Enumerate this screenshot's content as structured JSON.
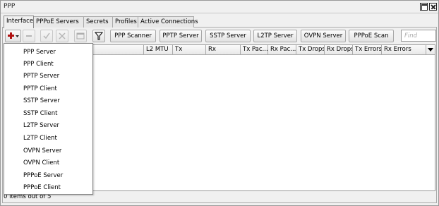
{
  "window": {
    "title": "PPP"
  },
  "tabs": [
    "Interface",
    "PPPoE Servers",
    "Secrets",
    "Profiles",
    "Active Connections"
  ],
  "toolbar": {
    "buttons": [
      "PPP Scanner",
      "PPTP Server",
      "SSTP Server",
      "L2TP Server",
      "OVPN Server",
      "PPPoE Scan"
    ],
    "find_placeholder": "Find",
    "add_icon_color": "#b01010"
  },
  "columns": [
    "L2 MTU",
    "Tx",
    "Rx",
    "Tx Pac...",
    "Rx Pac...",
    "Tx Drops",
    "Rx Drops",
    "Tx Errors",
    "Rx Errors"
  ],
  "add_menu": [
    "PPP Server",
    "PPP Client",
    "PPTP Server",
    "PPTP Client",
    "SSTP Server",
    "SSTP Client",
    "L2TP Server",
    "L2TP Client",
    "OVPN Server",
    "OVPN Client",
    "PPPoE Server",
    "PPPoE Client"
  ],
  "status": {
    "text": "0 items out of 5"
  }
}
